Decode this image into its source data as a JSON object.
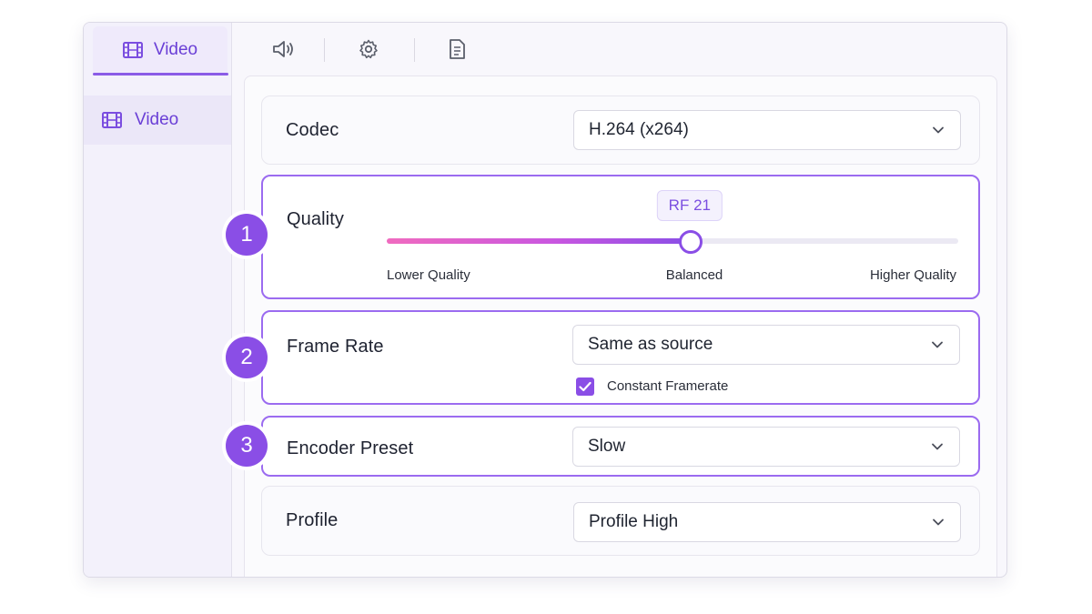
{
  "sidebar": {
    "tab_label": "Video",
    "tab_icon": "film-icon",
    "items": [
      {
        "label": "Video",
        "icon": "film-icon"
      }
    ]
  },
  "toolbar": {
    "icons": [
      "speaker-icon",
      "gear-icon",
      "document-icon"
    ]
  },
  "codec": {
    "label": "Codec",
    "value": "H.264 (x264)"
  },
  "quality": {
    "badge": "1",
    "label": "Quality",
    "value_label": "RF 21",
    "position_fraction": 0.53,
    "tick_left": "Lower Quality",
    "tick_mid": "Balanced",
    "tick_right": "Higher Quality"
  },
  "frame_rate": {
    "badge": "2",
    "label": "Frame Rate",
    "value": "Same as source",
    "checkbox_label": "Constant Framerate",
    "checkbox_checked": true
  },
  "encoder_preset": {
    "badge": "3",
    "label": "Encoder Preset",
    "value": "Slow"
  },
  "profile": {
    "label": "Profile",
    "value": "Profile High"
  },
  "colors": {
    "accent": "#8a4ee6",
    "accent_text": "#6a3fd6",
    "gradient_start": "#f06bbf"
  }
}
